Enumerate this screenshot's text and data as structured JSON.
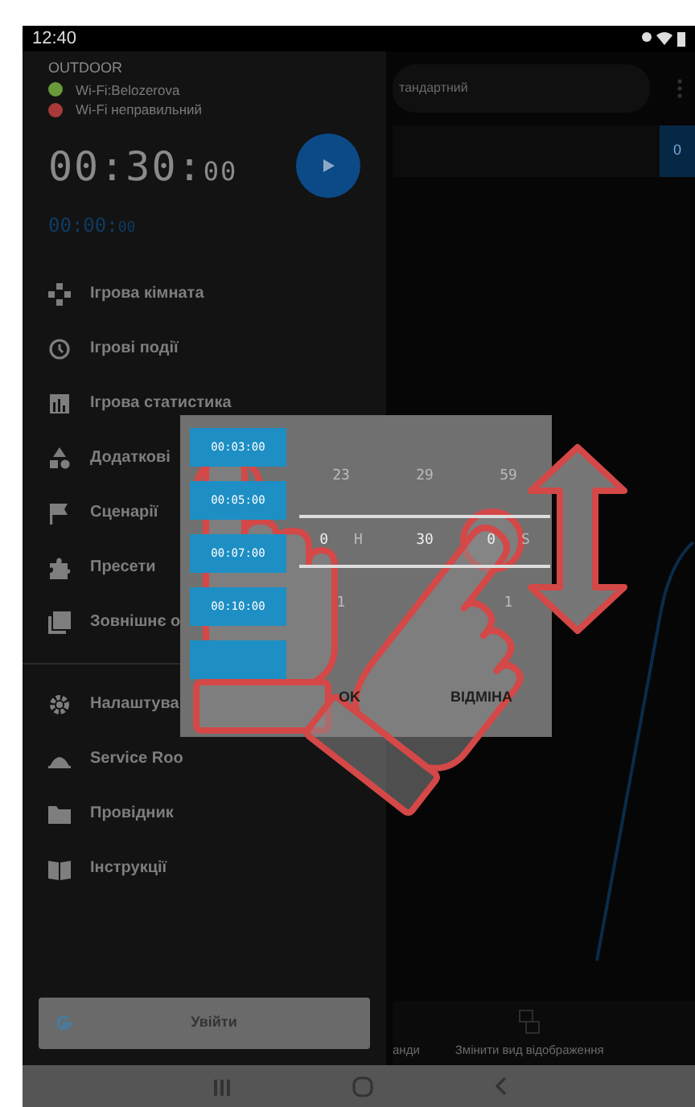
{
  "status_bar": {
    "time": "12:40"
  },
  "drawer": {
    "title": "OUTDOOR",
    "networks": [
      {
        "label": "Wi-Fi:Belozerova",
        "color": "#6a9a3a"
      },
      {
        "label": "Wi-Fi неправильний",
        "color": "#a83a3a"
      }
    ],
    "timer": {
      "main": "00:30:",
      "small": "00"
    },
    "elapsed": {
      "main": "00:00:",
      "small": "00"
    },
    "menu_groups": [
      [
        "Ігрова кімната",
        "Ігрові події",
        "Ігрова статистика",
        "Додаткові",
        "Сценарії",
        "Пресети",
        "Зовнішнє о"
      ],
      [
        "Налаштува",
        "Service Roo",
        "Провідник",
        "Інструкції"
      ]
    ],
    "sign_in": "Увійти"
  },
  "background": {
    "mode_field": "тандартний",
    "counter": "0",
    "bottom_bar": [
      "анди",
      "Змінити вид відображення"
    ]
  },
  "dialog": {
    "presets": [
      "00:03:00",
      "00:05:00",
      "00:07:00",
      "00:10:00"
    ],
    "columns": [
      {
        "above": "23",
        "value": "0",
        "unit": "H",
        "below": "1"
      },
      {
        "above": "29",
        "value": "30"
      },
      {
        "above": "59",
        "value": "0",
        "unit": "S",
        "below": "1"
      }
    ],
    "buttons": [
      "OK",
      "ВІДМІНА"
    ]
  }
}
